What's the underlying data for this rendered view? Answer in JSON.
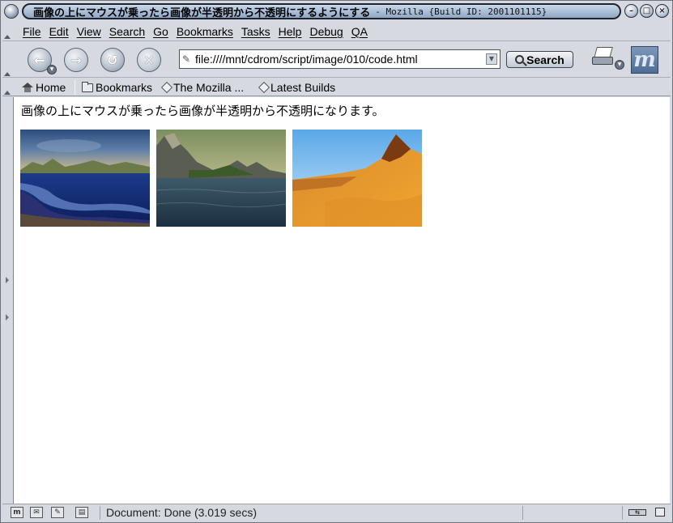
{
  "window": {
    "title": "画像の上にマウスが乗ったら画像が半透明から不透明にするようにする",
    "subtitle": "- Mozilla {Build ID: 2001101115}"
  },
  "menu": {
    "items": [
      {
        "label": "File"
      },
      {
        "label": "Edit"
      },
      {
        "label": "View"
      },
      {
        "label": "Search"
      },
      {
        "label": "Go"
      },
      {
        "label": "Bookmarks"
      },
      {
        "label": "Tasks"
      },
      {
        "label": "Help"
      },
      {
        "label": "Debug"
      },
      {
        "label": "QA"
      }
    ]
  },
  "navigation": {
    "url": "file:////mnt/cdrom/script/image/010/code.html",
    "search_label": "Search"
  },
  "personal_toolbar": {
    "home": "Home",
    "bookmarks": "Bookmarks",
    "mozilla": "The Mozilla ...",
    "latest_builds": "Latest Builds"
  },
  "page": {
    "text": "画像の上にマウスが乗ったら画像が半透明から不透明になります。",
    "images": [
      {
        "name": "coast-landscape-image"
      },
      {
        "name": "lake-mountains-image"
      },
      {
        "name": "desert-mountain-image"
      }
    ]
  },
  "status": {
    "text": "Document: Done (3.019 secs)"
  }
}
